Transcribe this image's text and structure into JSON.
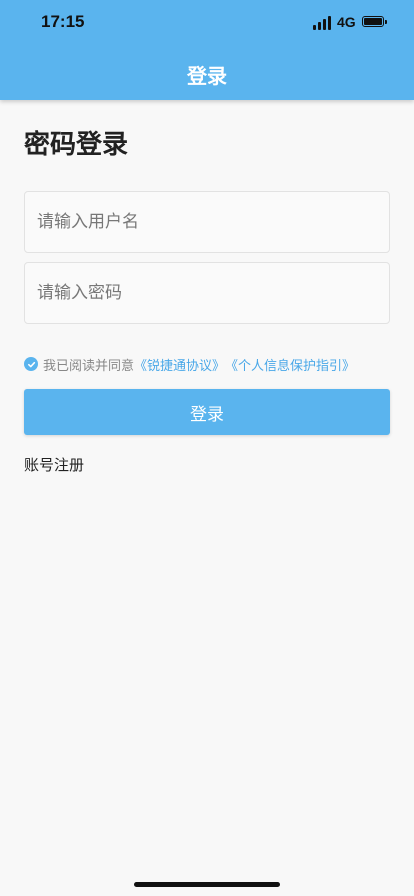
{
  "status_bar": {
    "time": "17:15",
    "network": "4G"
  },
  "header": {
    "title": "登录"
  },
  "page": {
    "title": "密码登录"
  },
  "form": {
    "username_placeholder": "请输入用户名",
    "password_placeholder": "请输入密码"
  },
  "agreement": {
    "prefix": "我已阅读并同意",
    "link1": "《锐捷通协议》",
    "link2": "《个人信息保护指引》"
  },
  "actions": {
    "login_label": "登录",
    "register_label": "账号注册"
  },
  "colors": {
    "accent": "#5ab4ee",
    "link": "#4aa8e8"
  }
}
